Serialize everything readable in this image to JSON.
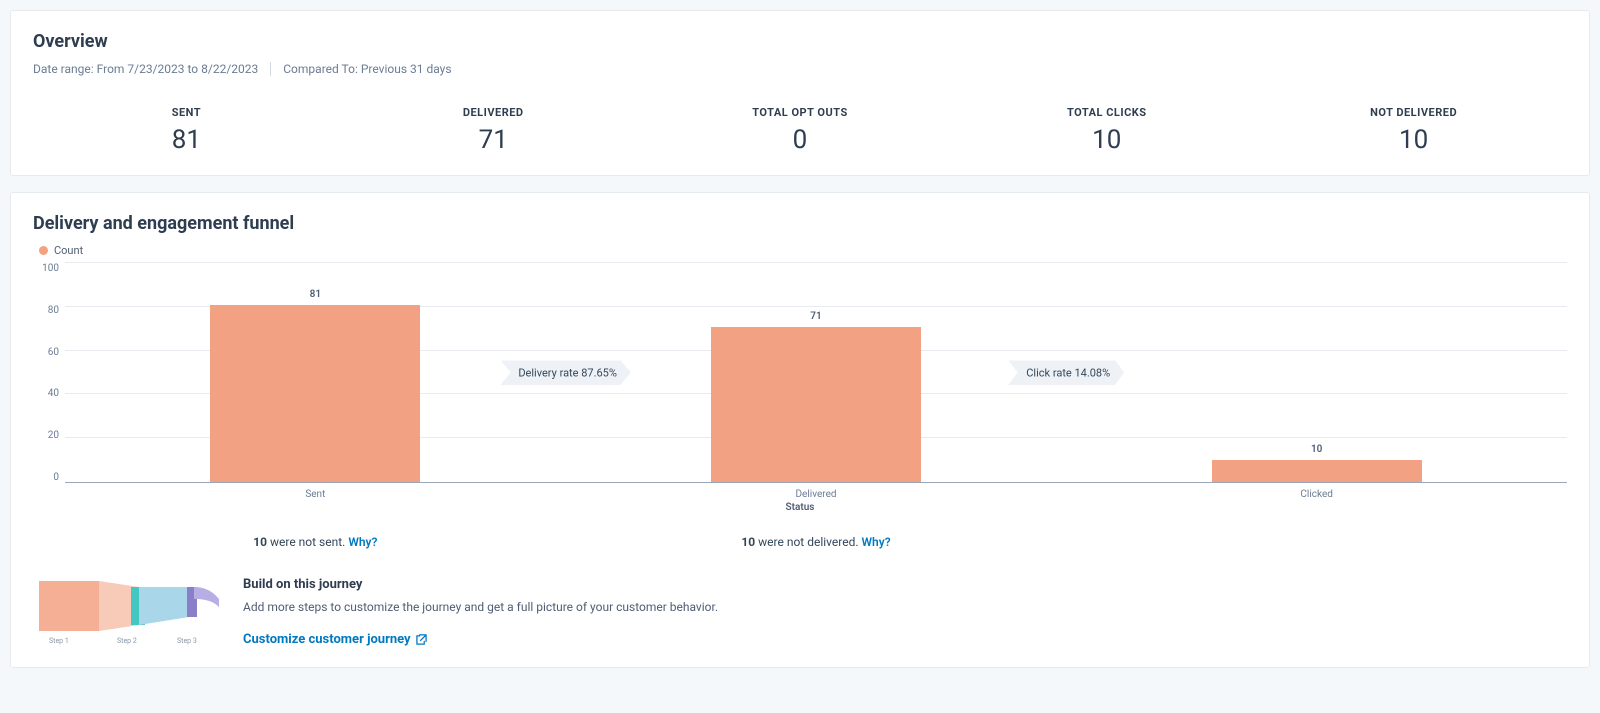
{
  "overview": {
    "title": "Overview",
    "date_range": "Date range: From 7/23/2023 to 8/22/2023",
    "compared_to": "Compared To: Previous 31 days",
    "stats": [
      {
        "label": "SENT",
        "value": "81"
      },
      {
        "label": "DELIVERED",
        "value": "71"
      },
      {
        "label": "TOTAL OPT OUTS",
        "value": "0"
      },
      {
        "label": "TOTAL CLICKS",
        "value": "10"
      },
      {
        "label": "NOT DELIVERED",
        "value": "10"
      }
    ]
  },
  "funnel": {
    "title": "Delivery and engagement funnel",
    "legend_label": "Count",
    "xlabel": "Status",
    "rate_badges": {
      "delivery": "Delivery rate 87.65%",
      "click": "Click rate 14.08%"
    },
    "messages": {
      "not_sent_count": "10",
      "not_sent_text": " were not sent. ",
      "not_delivered_count": "10",
      "not_delivered_text": " were not delivered. ",
      "why": "Why?"
    },
    "journey": {
      "title": "Build on this journey",
      "desc": "Add more steps to customize the journey and get a full picture of your customer behavior.",
      "cta": "Customize customer journey",
      "thumb_labels": [
        "Step 1",
        "Step 2",
        "Step 3"
      ]
    }
  },
  "chart_data": {
    "type": "bar",
    "categories": [
      "Sent",
      "Delivered",
      "Clicked"
    ],
    "values": [
      81,
      71,
      10
    ],
    "title": "Delivery and engagement funnel",
    "xlabel": "Status",
    "ylabel": "",
    "ylim": [
      0,
      100
    ],
    "yticks": [
      0,
      20,
      40,
      60,
      80,
      100
    ],
    "series_name": "Count",
    "annotations": [
      {
        "between": [
          "Sent",
          "Delivered"
        ],
        "text": "Delivery rate 87.65%"
      },
      {
        "between": [
          "Delivered",
          "Clicked"
        ],
        "text": "Click rate 14.08%"
      }
    ]
  }
}
